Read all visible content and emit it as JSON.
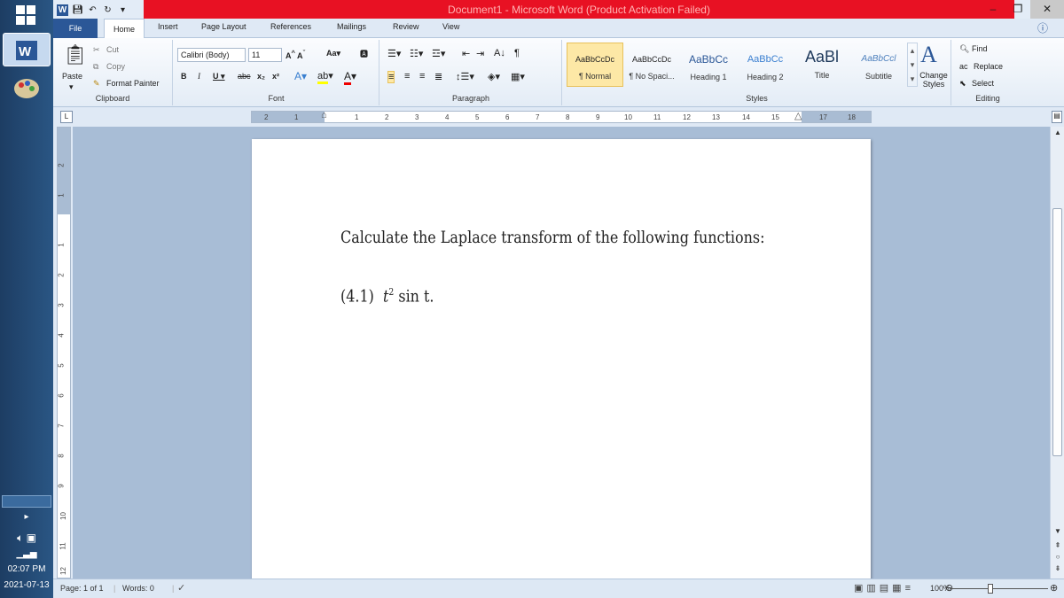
{
  "window": {
    "title": "Document1 - Microsoft Word (Product Activation Failed)"
  },
  "tabs": [
    "File",
    "Home",
    "Insert",
    "Page Layout",
    "References",
    "Mailings",
    "Review",
    "View"
  ],
  "clipboard": {
    "paste": "Paste",
    "cut": "Cut",
    "copy": "Copy",
    "format_painter": "Format Painter",
    "label": "Clipboard"
  },
  "font": {
    "name": "Calibri (Body)",
    "size": "11",
    "label": "Font"
  },
  "paragraph": {
    "label": "Paragraph"
  },
  "styles": {
    "items": [
      {
        "preview": "AaBbCcDc",
        "name": "¶ Normal"
      },
      {
        "preview": "AaBbCcDc",
        "name": "¶ No Spaci..."
      },
      {
        "preview": "AaBbCc",
        "name": "Heading 1"
      },
      {
        "preview": "AaBbCc",
        "name": "Heading 2"
      },
      {
        "preview": "AaBl",
        "name": "Title"
      },
      {
        "preview": "AaBbCcl",
        "name": "Subtitle"
      }
    ],
    "change_styles": "Change Styles",
    "label": "Styles"
  },
  "editing": {
    "find": "Find",
    "replace": "Replace",
    "select": "Select",
    "label": "Editing"
  },
  "ruler": {
    "marks": [
      "2",
      "1",
      "1",
      "2",
      "3",
      "4",
      "5",
      "6",
      "7",
      "8",
      "9",
      "10",
      "11",
      "12",
      "13",
      "14",
      "15",
      "17",
      "18"
    ]
  },
  "vruler": {
    "marks": [
      "2",
      "1",
      "1",
      "2",
      "3",
      "4",
      "5",
      "6",
      "7",
      "8",
      "9",
      "10",
      "11",
      "12"
    ]
  },
  "document": {
    "line1": "Calculate the Laplace transform of the following functions:",
    "line2_label": "(4.1)",
    "line2_base": "t",
    "line2_exp": "2",
    "line2_rest": "sin t."
  },
  "status": {
    "page": "Page: 1 of 1",
    "words": "Words: 0",
    "zoom": "100%"
  },
  "system": {
    "time": "02:07 PM",
    "date": "2021-07-13"
  },
  "colors": {
    "title_bar": "#e81123",
    "file_tab": "#2b5797",
    "taskbar": "#1d3d63"
  }
}
